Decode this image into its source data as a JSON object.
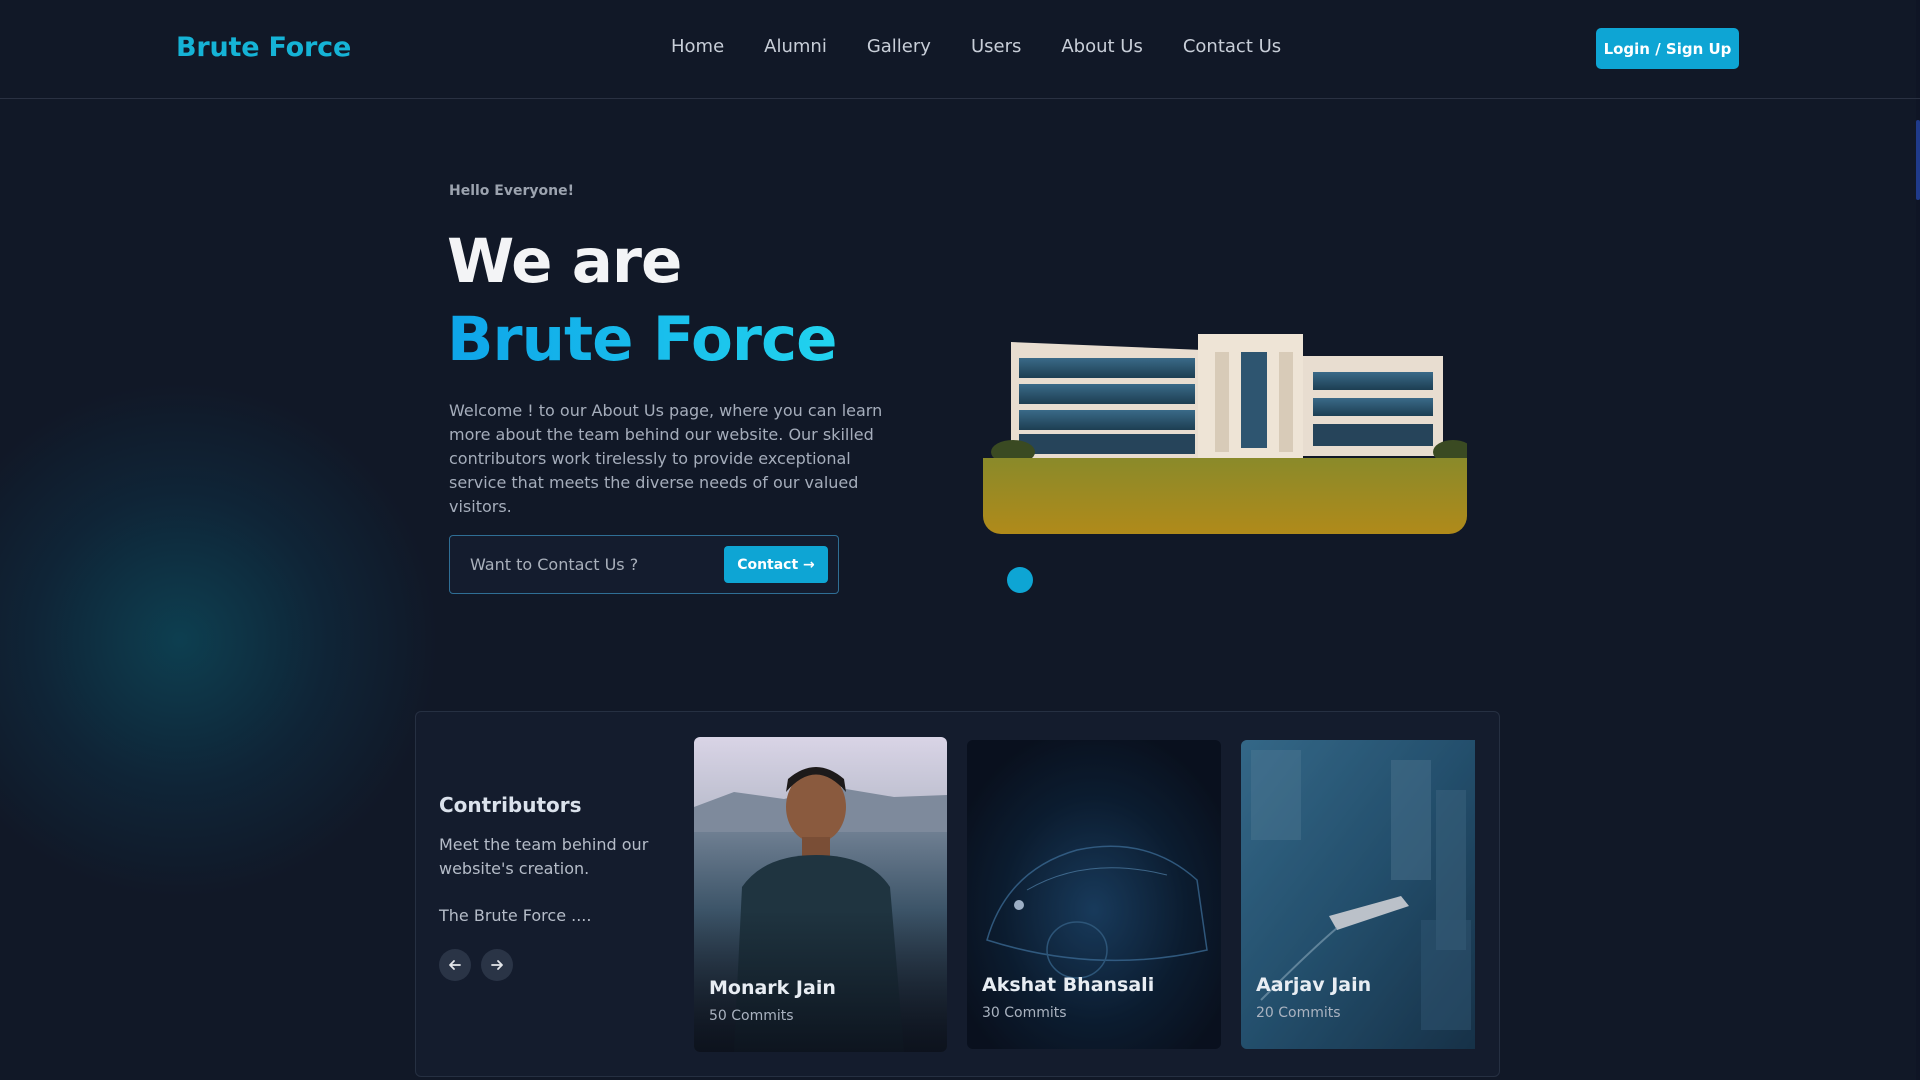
{
  "brand": "Brute Force",
  "nav": {
    "items": [
      {
        "label": "Home"
      },
      {
        "label": "Alumni"
      },
      {
        "label": "Gallery"
      },
      {
        "label": "Users"
      },
      {
        "label": "About Us"
      },
      {
        "label": "Contact Us"
      }
    ]
  },
  "header": {
    "login_label": "Login / Sign Up"
  },
  "hero": {
    "greeting": "Hello Everyone!",
    "title_line1": "We are",
    "title_line2": "Brute Force",
    "intro": "Welcome ! to our About Us page, where you can learn more about the team behind our website. Our skilled contributors work tirelessly to provide exceptional service that meets the diverse needs of our valued visitors.",
    "contact_placeholder": "Want to Contact Us ?",
    "contact_button": "Contact →"
  },
  "contributors": {
    "title": "Contributors",
    "description": "Meet the team behind our website's creation.",
    "tagline": "The Brute Force ....",
    "cards": [
      {
        "name": "Monark Jain",
        "commits": "50 Commits"
      },
      {
        "name": "Akshat Bhansali",
        "commits": "30 Commits"
      },
      {
        "name": "Aarjav Jain",
        "commits": "20 Commits"
      }
    ]
  },
  "colors": {
    "accent": "#0ea5d4",
    "background": "#111827",
    "brand": "#15b3d6"
  },
  "icons": {
    "prev": "arrow-left-icon",
    "next": "arrow-right-icon"
  }
}
